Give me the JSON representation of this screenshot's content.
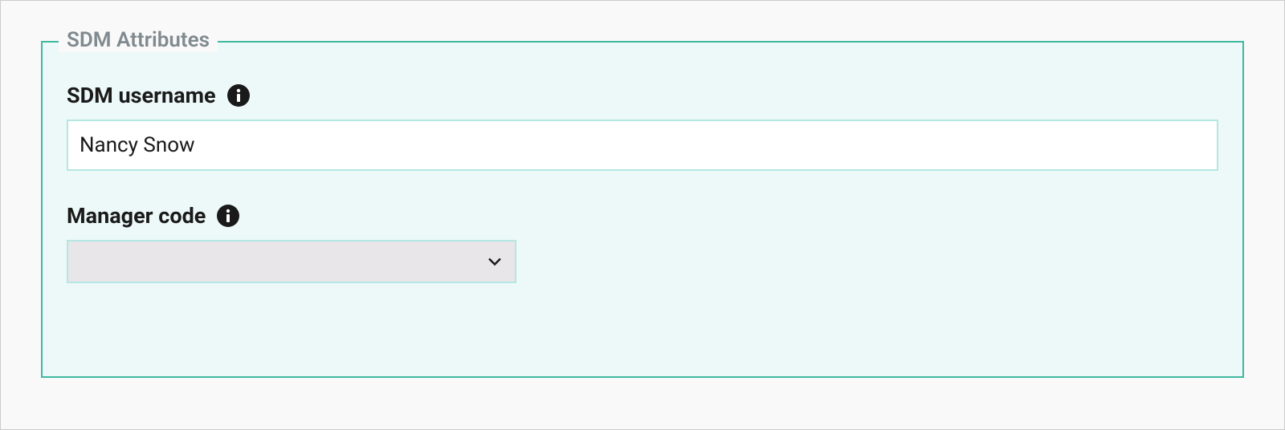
{
  "fieldset": {
    "legend": "SDM Attributes",
    "fields": {
      "username": {
        "label": "SDM username",
        "value": "Nancy Snow"
      },
      "manager_code": {
        "label": "Manager code",
        "value": ""
      }
    }
  }
}
